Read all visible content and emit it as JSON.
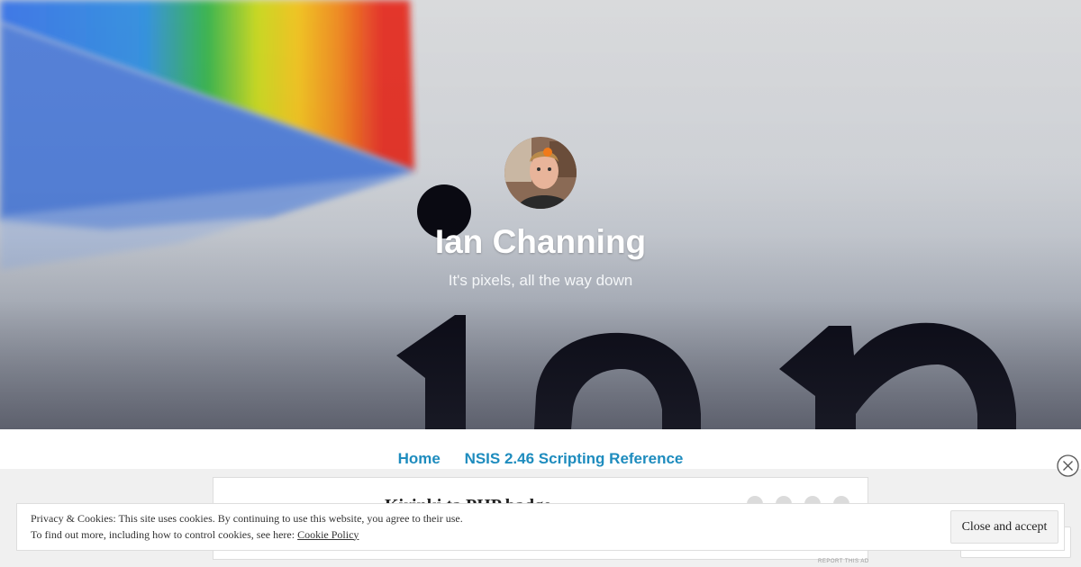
{
  "site": {
    "title": "Ian Channing",
    "tagline": "It's pixels, all the way down"
  },
  "nav": {
    "items": [
      {
        "label": "Home"
      },
      {
        "label": "NSIS 2.46 Scripting Reference"
      }
    ]
  },
  "post": {
    "title_partial": "Kirinki ta PHP badge"
  },
  "ad": {
    "report_label": "REPORT THIS AD"
  },
  "cookie_banner": {
    "line1": "Privacy & Cookies: This site uses cookies. By continuing to use this website, you agree to their use.",
    "line2_prefix": "To find out more, including how to control cookies, see here: ",
    "policy_link": "Cookie Policy",
    "accept_label": "Close and accept"
  },
  "icons": {
    "dismiss": "close-circle-icon",
    "share": [
      "wordpress-icon",
      "info-icon",
      "star-icon",
      "reblog-icon"
    ]
  },
  "colors": {
    "link": "#1e8cbe",
    "content_bg": "#f0f0f0"
  }
}
